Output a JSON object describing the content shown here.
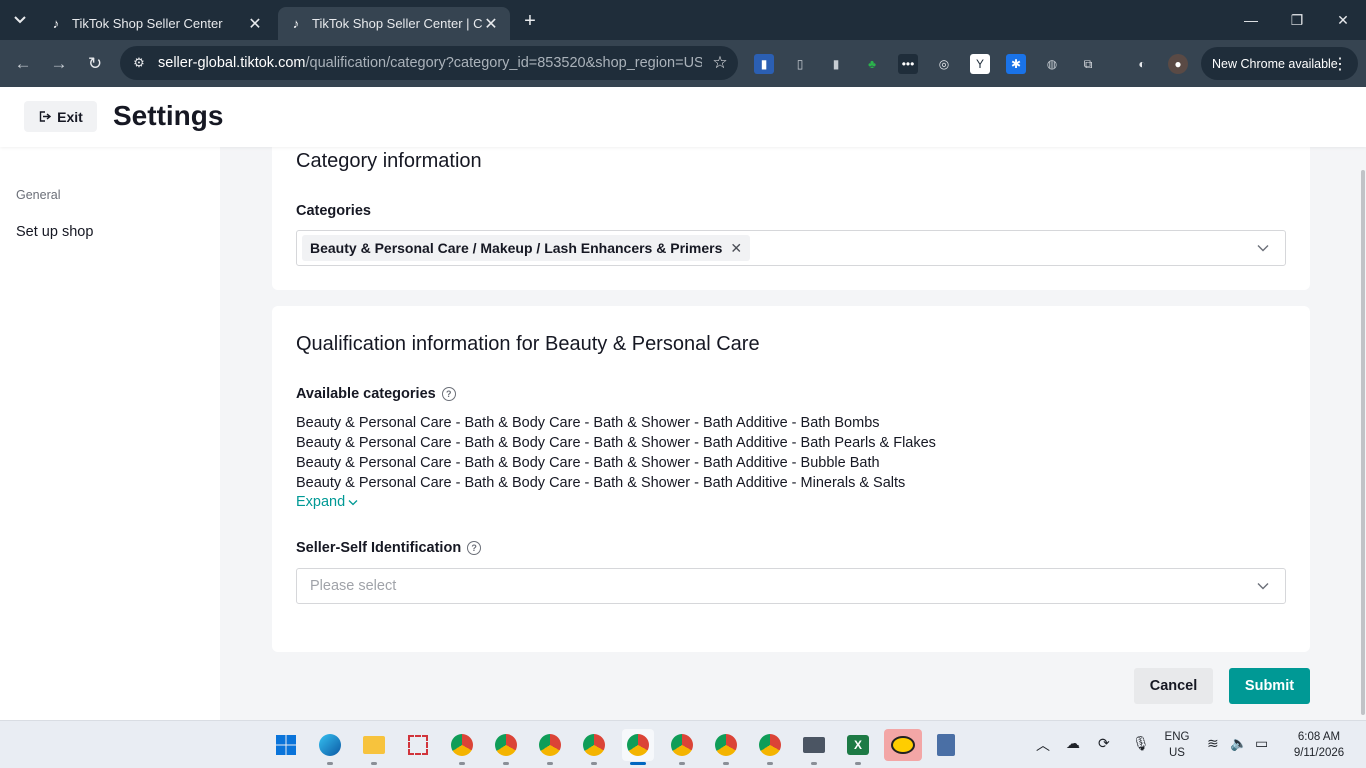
{
  "browser": {
    "tabs": [
      {
        "title": "TikTok Shop Seller Center",
        "active": false
      },
      {
        "title": "TikTok Shop Seller Center | Cros",
        "active": true
      }
    ],
    "url_host": "seller-global.tiktok.com",
    "url_path": "/qualification/category?category_id=853520&shop_region=US",
    "new_chrome_label": "New Chrome available"
  },
  "header": {
    "exit_label": "Exit",
    "title": "Settings"
  },
  "sidebar": {
    "section_label": "General",
    "items": [
      {
        "label": "Set up shop"
      }
    ]
  },
  "category_card": {
    "title": "Category information",
    "categories_label": "Categories",
    "selected_tag": "Beauty & Personal Care / Makeup / Lash Enhancers & Primers"
  },
  "qualification_card": {
    "title": "Qualification information for Beauty & Personal Care",
    "available_label": "Available categories",
    "available_categories": [
      "Beauty & Personal Care - Bath & Body Care - Bath & Shower - Bath Additive - Bath Bombs",
      "Beauty & Personal Care - Bath & Body Care - Bath & Shower - Bath Additive - Bath Pearls & Flakes",
      "Beauty & Personal Care - Bath & Body Care - Bath & Shower - Bath Additive - Bubble Bath",
      "Beauty & Personal Care - Bath & Body Care - Bath & Shower - Bath Additive - Minerals & Salts"
    ],
    "expand_label": "Expand",
    "seller_id_label": "Seller-Self Identification",
    "seller_id_placeholder": "Please select"
  },
  "actions": {
    "cancel_label": "Cancel",
    "submit_label": "Submit"
  },
  "taskbar": {
    "language": "ENG",
    "region": "US",
    "time": "6:08 AM",
    "date": "9/11/2026"
  },
  "colors": {
    "accent": "#009995",
    "chrome_dark": "#1f2d3a",
    "chrome_toolbar": "#364451"
  }
}
